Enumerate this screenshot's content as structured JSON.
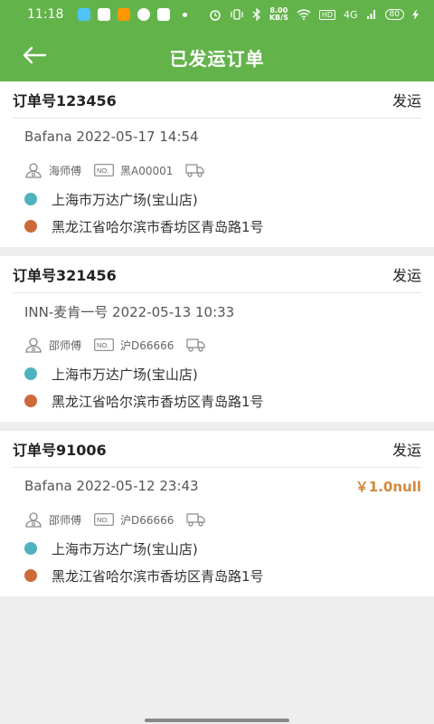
{
  "status_bar": {
    "time": "11:18",
    "speed_value": "8.00",
    "speed_unit": "KB/S",
    "hd": "HD",
    "network": "4G",
    "battery": "80"
  },
  "header": {
    "title": "已发运订单",
    "back_icon": "arrow-left-icon"
  },
  "colors": {
    "primary": "#63b34b",
    "origin_dot": "#4fb3bf",
    "destination_dot": "#cd6a3a",
    "price": "#d08a3d"
  },
  "orders": [
    {
      "order_no": "订单号123456",
      "status": "发运",
      "info": "Bafana 2022-05-17 14:54",
      "price": "",
      "driver": "海师傅",
      "no_label": "NO.",
      "plate": "黑A00001",
      "origin": "上海市万达广场(宝山店)",
      "destination": "黑龙江省哈尔滨市香坊区青岛路1号"
    },
    {
      "order_no": "订单号321456",
      "status": "发运",
      "info": "INN-麦肯一号 2022-05-13 10:33",
      "price": "",
      "driver": "邵师傅",
      "no_label": "NO.",
      "plate": "沪D66666",
      "origin": "上海市万达广场(宝山店)",
      "destination": "黑龙江省哈尔滨市香坊区青岛路1号"
    },
    {
      "order_no": "订单号91006",
      "status": "发运",
      "info": "Bafana 2022-05-12 23:43",
      "price": "￥1.0null",
      "driver": "邵师傅",
      "no_label": "NO.",
      "plate": "沪D66666",
      "origin": "上海市万达广场(宝山店)",
      "destination": "黑龙江省哈尔滨市香坊区青岛路1号"
    }
  ]
}
